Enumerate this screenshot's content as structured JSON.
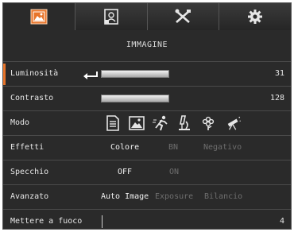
{
  "tabs": [
    {
      "name": "image-settings",
      "icon": "image-settings-icon",
      "active": true,
      "accent": "#e8742a"
    },
    {
      "name": "display",
      "icon": "display-portrait-icon",
      "active": false
    },
    {
      "name": "tools",
      "icon": "tools-icon",
      "active": false
    },
    {
      "name": "system",
      "icon": "gear-icon",
      "active": false
    }
  ],
  "title": "IMMAGINE",
  "rows": {
    "luminosita": {
      "label": "Luminosità",
      "value": "31",
      "selected": true
    },
    "contrasto": {
      "label": "Contrasto",
      "value": "128"
    },
    "modo": {
      "label": "Modo",
      "icons": [
        "document-icon",
        "photo-icon",
        "motion-runner-icon",
        "microscope-icon",
        "macro-flower-icon",
        "telescope-icon"
      ]
    },
    "effetti": {
      "label": "Effetti",
      "options": [
        "Colore",
        "BN",
        "Negativo"
      ],
      "selected": "Colore"
    },
    "specchio": {
      "label": "Specchio",
      "options": [
        "OFF",
        "ON"
      ],
      "selected": "OFF"
    },
    "avanzato": {
      "label": "Avanzato",
      "options": [
        "Auto Image",
        "Exposure",
        "Bilancio"
      ],
      "selected": "Auto Image"
    },
    "mettere": {
      "label": "Mettere a fuoco",
      "value": "4"
    }
  },
  "colors": {
    "accent": "#e8742a",
    "background": "#2a2a2a",
    "inactive_text": "#6e6e6e"
  }
}
